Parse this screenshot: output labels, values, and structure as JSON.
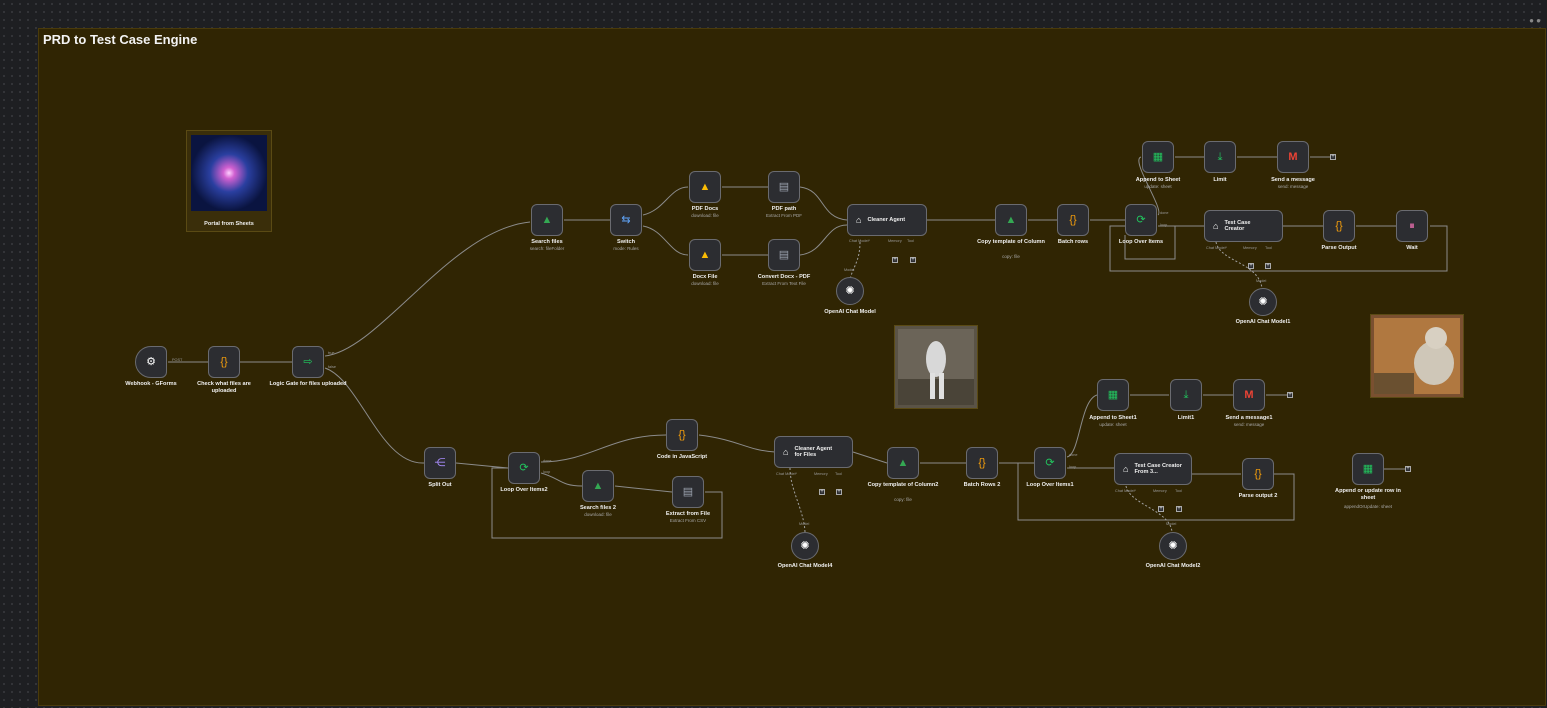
{
  "workflow": {
    "title": "PRD to Test Case Engine"
  },
  "images": {
    "portal_label": "Portal from Sheets"
  },
  "nodes": {
    "webhook": {
      "label": "Webhook - GForms",
      "port": "POST"
    },
    "check_files": {
      "label": "Check what files are uploaded"
    },
    "logic_gate": {
      "label": "Logic Gate for files uploaded",
      "port_true": "true",
      "port_false": "false"
    },
    "search_files": {
      "label": "Search files",
      "sub": "search: fileFolder"
    },
    "switch": {
      "label": "Switch",
      "sub": "mode: Rules"
    },
    "pdf_docs": {
      "label": "PDF Docs",
      "sub": "download: file"
    },
    "docx_file": {
      "label": "Docx File",
      "sub": "download: file"
    },
    "pdf_path": {
      "label": "PDF path",
      "sub": "Extract From PDF"
    },
    "convert_docx": {
      "label": "Convert Docx - PDF",
      "sub": "Extract From Text File"
    },
    "cleaner_agent": {
      "label": "Cleaner Agent",
      "p1": "Chat Model*",
      "p2": "Memory",
      "p3": "Tool"
    },
    "openai1": {
      "label": "OpenAI Chat Model",
      "port": "Model"
    },
    "copy_template": {
      "label": "Copy template of Column",
      "sub": "copy: file"
    },
    "batch_rows": {
      "label": "Batch rows"
    },
    "loop_items": {
      "label": "Loop Over Items",
      "p_done": "done",
      "p_loop": "loop"
    },
    "append_sheet": {
      "label": "Append to Sheet",
      "sub": "update: sheet"
    },
    "limit": {
      "label": "Limit"
    },
    "send_message": {
      "label": "Send a message",
      "sub": "send: message"
    },
    "tc_creator": {
      "label": "Test Case Creator",
      "p1": "Chat Model*",
      "p2": "Memory",
      "p3": "Tool"
    },
    "parse_output": {
      "label": "Parse Output"
    },
    "wait": {
      "label": "Wait"
    },
    "openai_model1": {
      "label": "OpenAI Chat Model1",
      "port": "Model"
    },
    "split_out": {
      "label": "Split Out"
    },
    "loop_items2": {
      "label": "Loop Over Items2",
      "p_done": "done",
      "p_loop": "loop"
    },
    "code_js": {
      "label": "Code in JavaScript"
    },
    "search_files2": {
      "label": "Search files 2",
      "sub": "download: file"
    },
    "extract_file": {
      "label": "Extract from File",
      "sub": "Extract From CSV"
    },
    "cleaner_agent2": {
      "label": "Cleaner Agent for Files",
      "p1": "Chat Model*",
      "p2": "Memory",
      "p3": "Tool"
    },
    "openai_model4": {
      "label": "OpenAI Chat Model4",
      "port": "Model"
    },
    "copy_template2": {
      "label": "Copy template of Column2",
      "sub": "copy: file"
    },
    "batch_rows2": {
      "label": "Batch Rows 2"
    },
    "loop_items1": {
      "label": "Loop Over Items1",
      "p_done": "done",
      "p_loop": "loop"
    },
    "append_sheet1": {
      "label": "Append to Sheet1",
      "sub": "update: sheet"
    },
    "limit1": {
      "label": "Limit1"
    },
    "send_message1": {
      "label": "Send a message1",
      "sub": "send: message"
    },
    "tc_creator3": {
      "label": "Test Case Creator From 3...",
      "p1": "Chat Model*",
      "p2": "Memory",
      "p3": "Tool"
    },
    "parse_output2": {
      "label": "Parse output 2"
    },
    "openai_model2": {
      "label": "OpenAI Chat Model2",
      "port": "Model"
    },
    "append_update": {
      "label": "Append or update row in sheet",
      "sub": "appendOrUpdate: sheet"
    }
  },
  "icons": {
    "plus": "+",
    "code": "{}"
  },
  "colors": {
    "canvas": "#1e1f22",
    "sticky": "#302503",
    "node": "#2c2d31",
    "edge": "#8b8b8b"
  }
}
